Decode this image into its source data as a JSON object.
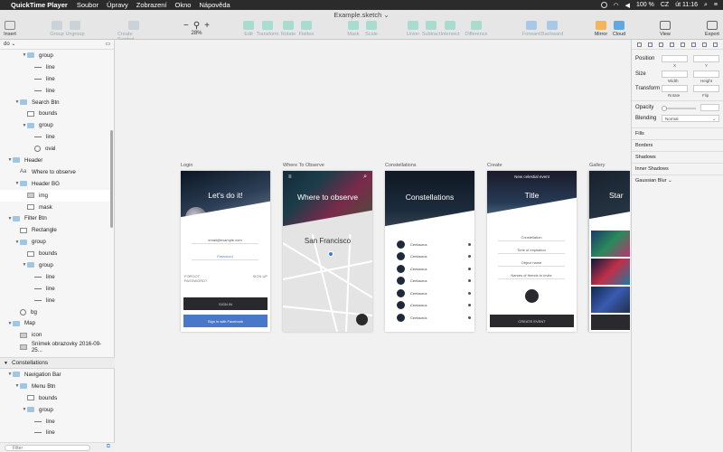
{
  "menubar": {
    "apple": "",
    "app": "QuickTime Player",
    "items": [
      "Soubor",
      "Úpravy",
      "Zobrazení",
      "Okno",
      "Nápověda"
    ],
    "battery": "100 %",
    "time": "út 11:16",
    "lang": "CZ"
  },
  "toolbar": {
    "title": "Example.sketch",
    "insert": "Insert",
    "group": "Group",
    "ungroup": "Ungroup",
    "create_symbol": "Create Symbol",
    "zoom": "28%",
    "edit": "Edit",
    "transform": "Transform",
    "rotate": "Rotate",
    "flatten": "Flatten",
    "mask": "Mask",
    "scale": "Scale",
    "union": "Union",
    "subtract": "Subtract",
    "intersect": "Intersect",
    "difference": "Difference",
    "forward": "Forward",
    "backward": "Backward",
    "mirror": "Mirror",
    "cloud": "Cloud",
    "view": "View",
    "export": "Export"
  },
  "layers": {
    "page": "do",
    "items": [
      {
        "label": "group",
        "kind": "folder",
        "indent": 3,
        "tri": "▼"
      },
      {
        "label": "line",
        "kind": "line",
        "indent": 4,
        "tri": ""
      },
      {
        "label": "line",
        "kind": "line",
        "indent": 4,
        "tri": ""
      },
      {
        "label": "line",
        "kind": "line",
        "indent": 4,
        "tri": ""
      },
      {
        "label": "Search Btn",
        "kind": "folder",
        "indent": 2,
        "tri": "▼"
      },
      {
        "label": "bounds",
        "kind": "shape",
        "indent": 3,
        "tri": ""
      },
      {
        "label": "group",
        "kind": "folder",
        "indent": 3,
        "tri": "▼"
      },
      {
        "label": "line",
        "kind": "line",
        "indent": 4,
        "tri": ""
      },
      {
        "label": "oval",
        "kind": "oval",
        "indent": 4,
        "tri": ""
      },
      {
        "label": "Header",
        "kind": "folder",
        "indent": 1,
        "tri": "▼"
      },
      {
        "label": "Where to observe",
        "kind": "text",
        "indent": 2,
        "tri": ""
      },
      {
        "label": "Header BG",
        "kind": "folder",
        "indent": 2,
        "tri": "▼"
      },
      {
        "label": "img",
        "kind": "img",
        "indent": 3,
        "tri": ""
      },
      {
        "label": "mask",
        "kind": "shape",
        "indent": 3,
        "tri": ""
      },
      {
        "label": "Filter Btn",
        "kind": "folder",
        "indent": 1,
        "tri": "▼"
      },
      {
        "label": "Rectangle",
        "kind": "shape",
        "indent": 2,
        "tri": ""
      },
      {
        "label": "group",
        "kind": "folder",
        "indent": 2,
        "tri": "▼"
      },
      {
        "label": "bounds",
        "kind": "shape",
        "indent": 3,
        "tri": ""
      },
      {
        "label": "group",
        "kind": "folder",
        "indent": 3,
        "tri": "▼"
      },
      {
        "label": "line",
        "kind": "line",
        "indent": 4,
        "tri": ""
      },
      {
        "label": "line",
        "kind": "line",
        "indent": 4,
        "tri": ""
      },
      {
        "label": "line",
        "kind": "line",
        "indent": 4,
        "tri": ""
      },
      {
        "label": "bg",
        "kind": "oval",
        "indent": 2,
        "tri": ""
      },
      {
        "label": "Map",
        "kind": "folder",
        "indent": 1,
        "tri": "▼"
      },
      {
        "label": "icon",
        "kind": "img",
        "indent": 2,
        "tri": ""
      },
      {
        "label": "Snímek obrazovky 2016-09-25...",
        "kind": "img",
        "indent": 2,
        "tri": ""
      }
    ],
    "section2": "Constellations",
    "items2": [
      {
        "label": "Navigation Bar",
        "kind": "folder",
        "indent": 1,
        "tri": "▼"
      },
      {
        "label": "Menu Btn",
        "kind": "folder",
        "indent": 2,
        "tri": "▼"
      },
      {
        "label": "bounds",
        "kind": "shape",
        "indent": 3,
        "tri": ""
      },
      {
        "label": "group",
        "kind": "folder",
        "indent": 3,
        "tri": "▼"
      },
      {
        "label": "line",
        "kind": "line",
        "indent": 4,
        "tri": ""
      },
      {
        "label": "line",
        "kind": "line",
        "indent": 4,
        "tri": ""
      }
    ],
    "filter_placeholder": "Filter"
  },
  "artboards": {
    "login": {
      "label": "Login",
      "title": "Let's do it!",
      "email": "email@example.com",
      "password": "Password",
      "forgot": "FORGOT PASSWORD?",
      "signup": "SIGN UP",
      "signin": "SIGN IN",
      "facebook": "Sign in with Facebook"
    },
    "where": {
      "label": "Where To Observe",
      "title": "Where to observe",
      "city": "San Francisco"
    },
    "const": {
      "label": "Constellations",
      "title": "Constellations",
      "rows": [
        "Centaurus",
        "Centaurus",
        "Centaurus",
        "Centaurus",
        "Centaurus",
        "Centaurus",
        "Centaurus"
      ]
    },
    "create": {
      "label": "Create",
      "header": "New celestial event",
      "title": "Title",
      "fields": [
        "Constellation",
        "Time of expiration",
        "Object name",
        "Names of friends to invite"
      ],
      "button": "CREATE EVENT"
    },
    "gallery": {
      "label": "Gallery",
      "title": "Star"
    }
  },
  "inspector": {
    "position": "Position",
    "x": "X",
    "y": "Y",
    "size": "Size",
    "width": "Width",
    "height": "Height",
    "transform": "Transform",
    "rotate": "Rotate",
    "flip": "Flip",
    "opacity": "Opacity",
    "blending": "Blending",
    "blending_value": "Normal",
    "fills": "Fills",
    "borders": "Borders",
    "shadows": "Shadows",
    "inner_shadows": "Inner Shadows",
    "gaussian_blur": "Gaussian Blur"
  }
}
